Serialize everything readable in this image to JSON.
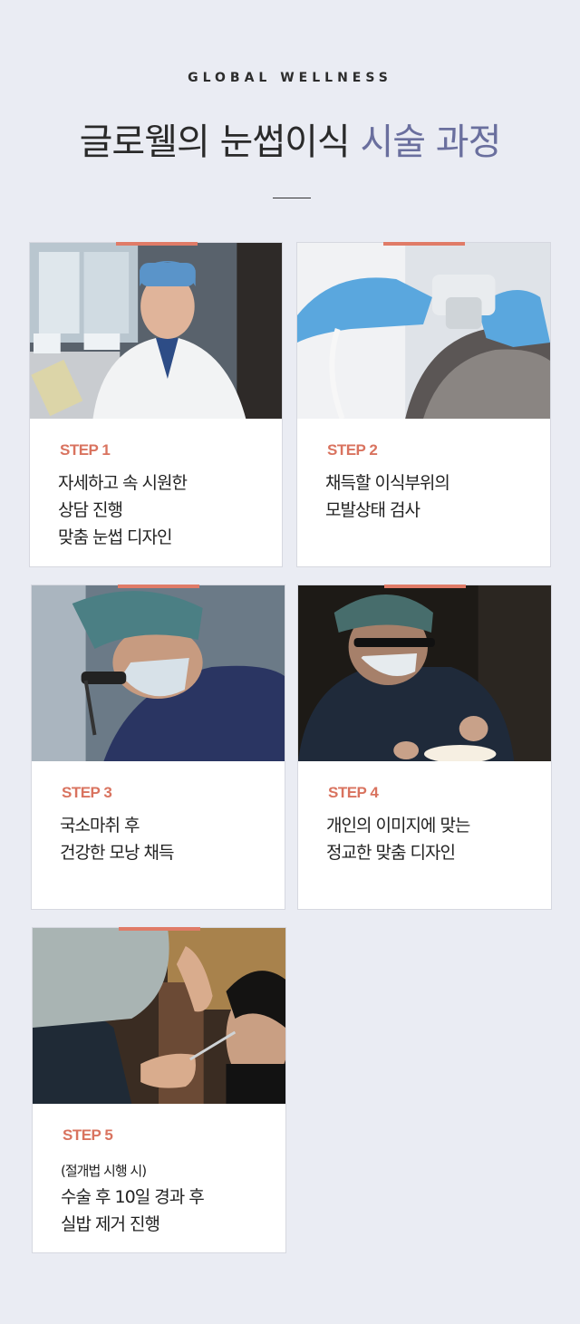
{
  "header": {
    "eyebrow": "GLOBAL WELLNESS",
    "title_main": "글로웰의 눈썹이식",
    "title_accent": "시술 과정",
    "accent_color": "#6a6f9e"
  },
  "steps": [
    {
      "label": "STEP 1",
      "lines": [
        "자세하고 속 시원한",
        "상담 진행",
        "맞춤 눈썹 디자인"
      ],
      "photo": "doctor-consultation-photo"
    },
    {
      "label": "STEP 2",
      "lines": [
        "채득할 이식부위의",
        "모발상태 검사"
      ],
      "photo": "scalp-inspection-photo"
    },
    {
      "label": "STEP 3",
      "lines": [
        "국소마취 후",
        "건강한 모낭 채득"
      ],
      "photo": "surgeon-loupes-photo"
    },
    {
      "label": "STEP 4",
      "lines": [
        "개인의 이미지에 맞는",
        "정교한 맞춤 디자인"
      ],
      "photo": "surgeon-operating-photo"
    },
    {
      "label": "STEP 5",
      "note": "(절개법 시행 시)",
      "lines": [
        "수술 후 10일 경과 후",
        "실밥 제거 진행"
      ],
      "photo": "suture-removal-photo"
    }
  ],
  "colors": {
    "background": "#eaecf3",
    "step_accent": "#e07b67"
  }
}
